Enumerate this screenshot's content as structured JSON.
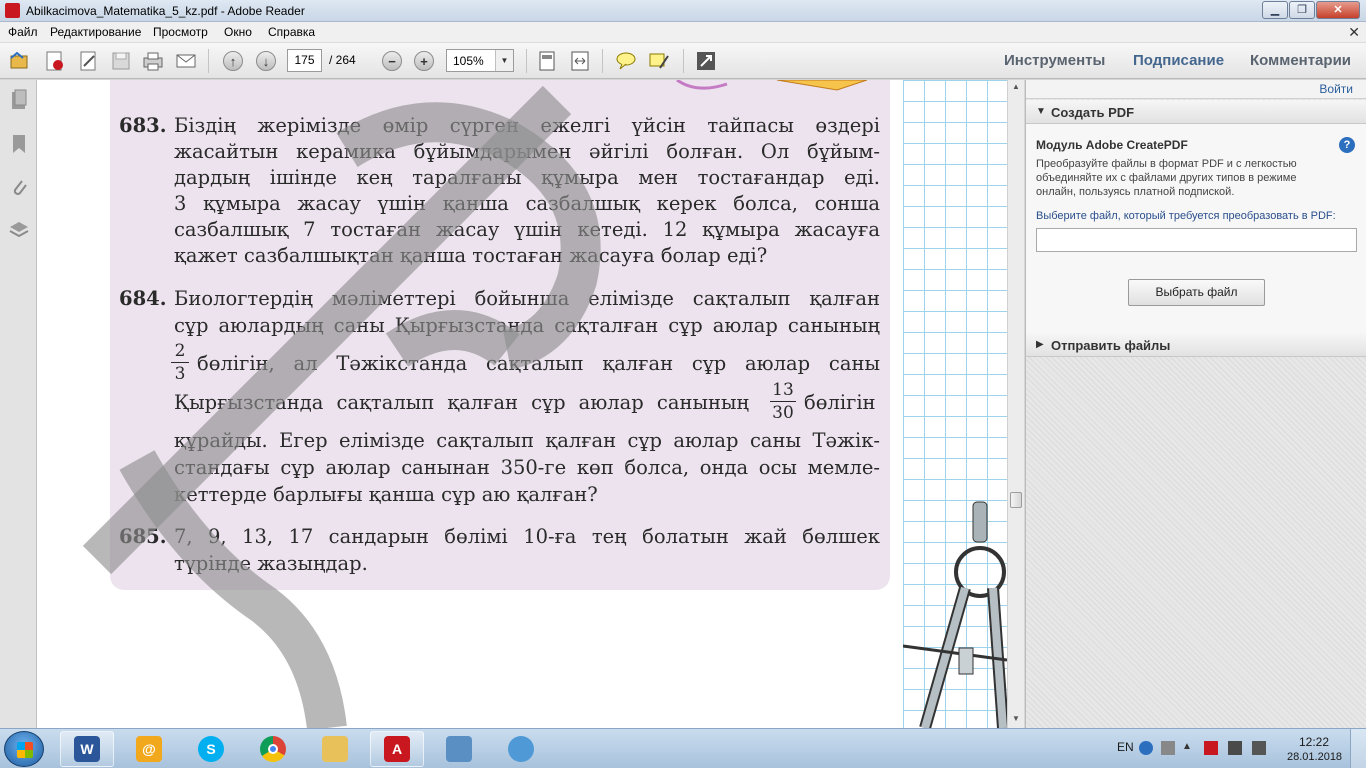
{
  "window": {
    "title": "Abilkacimova_Matematika_5_kz.pdf - Adobe Reader",
    "controls": {
      "minimize": "▁",
      "maximize": "❐",
      "close": "✕"
    }
  },
  "menu": {
    "items": [
      "Файл",
      "Редактирование",
      "Просмотр",
      "Окно",
      "Справка"
    ],
    "close_glyph": "✕"
  },
  "toolbar": {
    "page_current": "175",
    "page_total": "/ 264",
    "zoom": "105%",
    "zoom_out": "−",
    "zoom_in": "+",
    "links": {
      "tools": "Инструменты",
      "sign": "Подписание",
      "comments": "Комментарии"
    }
  },
  "document": {
    "problem_683": {
      "number": "683.",
      "lines": [
        "Біздің жерімізде өмір сүрген ежелгі үйсін тайпасы өздері",
        "жасайтын керамика бұйымдарымен әйгілі болған. Ол бұйым-",
        "дардың ішінде кең таралғаны құмыра мен тостағандар еді.",
        "3 құмыра жасау үшін қанша сазбалшық керек болса, сонша",
        "сазбалшық 7 тостаған жасау үшін кетеді. 12 құмыра жасауға",
        "қажет сазбалшықтан қанша тостаған жасауға болар еді?"
      ]
    },
    "problem_684": {
      "number": "684.",
      "lines": [
        "Биологтердің мәліметтері бойынша елімізде сақталып қалған",
        "сұр аюлардың саны Қырғызстанда сақталған сұр аюлар санының",
        "бөлігін, ал Тәжікстанда сақталып қалған сұр аюлар саны",
        "Қырғызстанда сақталып қалған сұр аюлар санының",
        "бөлігін",
        "құрайды. Егер елімізде сақталып қалған сұр аюлар саны Тәжік-",
        "стандағы сұр аюлар санынан 350-ге көп болса, онда осы мемле-",
        "кеттерде барлығы қанша сұр аю қалған?"
      ],
      "fraction_1": {
        "num": "2",
        "den": "3"
      },
      "fraction_2": {
        "num": "13",
        "den": "30"
      }
    },
    "problem_685": {
      "number": "685.",
      "lines": [
        "7, 9, 13, 17 сандарын бөлімі 10-ға тең болатын жай бөлшек",
        "түрінде жазыңдар."
      ]
    }
  },
  "right_panel": {
    "login": "Войти",
    "create_pdf": {
      "header": "Создать PDF",
      "module_title": "Модуль Adobe CreatePDF",
      "help": "?",
      "description": "Преобразуйте файлы в формат PDF и с легкостью объединяйте их с файлами других типов в режиме онлайн, пользуясь платной подпиской.",
      "select_label": "Выберите файл, который требуется преобразовать в PDF:",
      "file_value": "",
      "choose_button": "Выбрать файл"
    },
    "send_files": {
      "header": "Отправить файлы"
    }
  },
  "taskbar": {
    "lang": "EN",
    "time": "12:22",
    "date": "28.01.2018",
    "apps": [
      "word",
      "mail",
      "skype",
      "chrome",
      "explorer",
      "acrobat",
      "network",
      "remote"
    ]
  },
  "colors": {
    "pink_box": "#ece3ee",
    "grid_line": "#9fd3ec",
    "accent_blue": "#44678f",
    "watermark": "#8d8d8d"
  }
}
